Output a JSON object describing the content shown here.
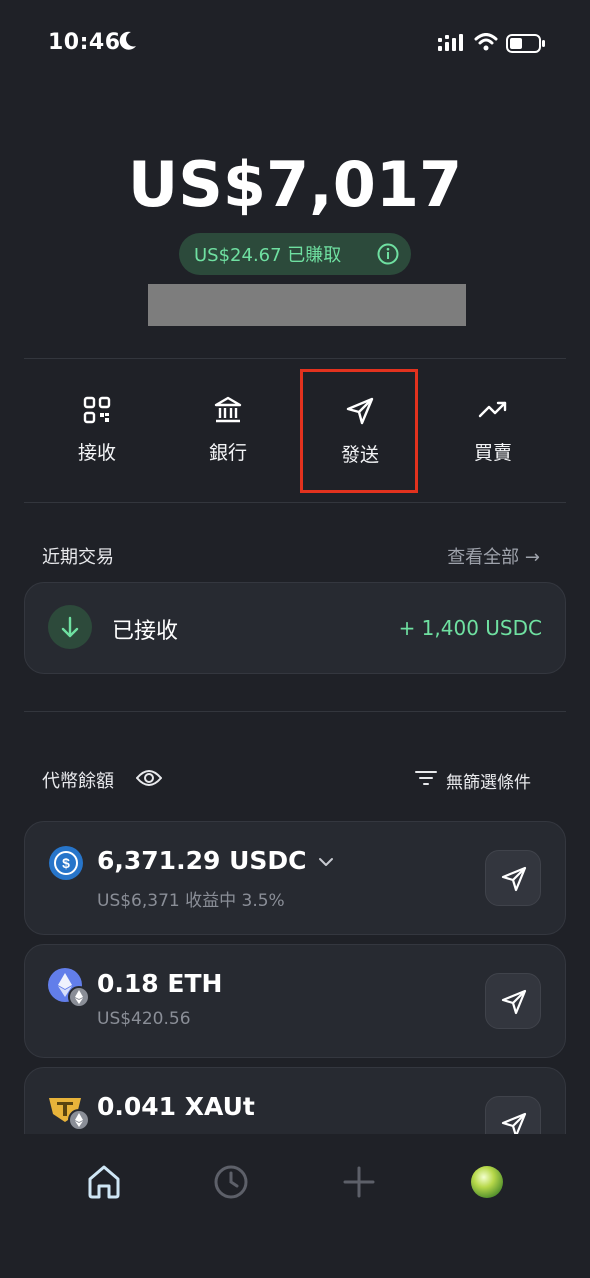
{
  "status_bar": {
    "time": "10:46"
  },
  "balance": {
    "total": "US$7,017",
    "earned": "US$24.67 已賺取"
  },
  "actions": [
    {
      "label": "接收",
      "icon": "qr-code-icon"
    },
    {
      "label": "銀行",
      "icon": "bank-icon"
    },
    {
      "label": "發送",
      "icon": "send-icon"
    },
    {
      "label": "買賣",
      "icon": "trend-up-icon"
    }
  ],
  "recent": {
    "title": "近期交易",
    "view_all": "查看全部 →",
    "item": {
      "label": "已接收",
      "amount": "+ 1,400 USDC"
    }
  },
  "tokens": {
    "title": "代幣餘額",
    "filter": "無篩選條件",
    "items": [
      {
        "name": "6,371.29 USDC",
        "sub": "US$6,371 收益中 3.5%",
        "icon": "usdc-icon"
      },
      {
        "name": "0.18 ETH",
        "sub": "US$420.56",
        "icon": "eth-icon"
      },
      {
        "name": "0.041 XAUt",
        "sub": "",
        "icon": "xaut-icon"
      }
    ]
  },
  "colors": {
    "background": "#1f2127",
    "accent_green": "#6fe0a1",
    "highlight": "#e2321e"
  }
}
